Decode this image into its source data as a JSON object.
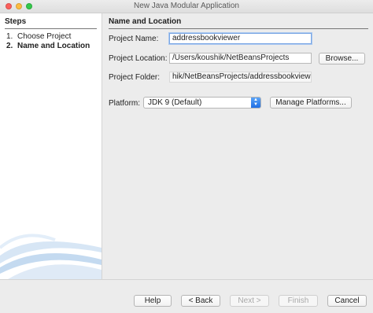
{
  "window": {
    "title": "New Java Modular Application"
  },
  "steps": {
    "heading": "Steps",
    "items": [
      {
        "num": "1.",
        "label": "Choose Project"
      },
      {
        "num": "2.",
        "label": "Name and Location"
      }
    ]
  },
  "form": {
    "heading": "Name and Location",
    "project_name": {
      "label": "Project Name:",
      "value": "addressbookviewer"
    },
    "project_location": {
      "label": "Project Location:",
      "value": "/Users/koushik/NetBeansProjects",
      "button": "Browse..."
    },
    "project_folder": {
      "label": "Project Folder:",
      "value": "hik/NetBeansProjects/addressbookviewer"
    },
    "platform": {
      "label": "Platform:",
      "selected": "JDK 9 (Default)",
      "button": "Manage Platforms..."
    }
  },
  "buttons": {
    "help": "Help",
    "back": "< Back",
    "next": "Next >",
    "finish": "Finish",
    "cancel": "Cancel"
  },
  "colors": {
    "focus_ring": "#7aa7e4",
    "select_arrow": "#1f6fe4"
  }
}
